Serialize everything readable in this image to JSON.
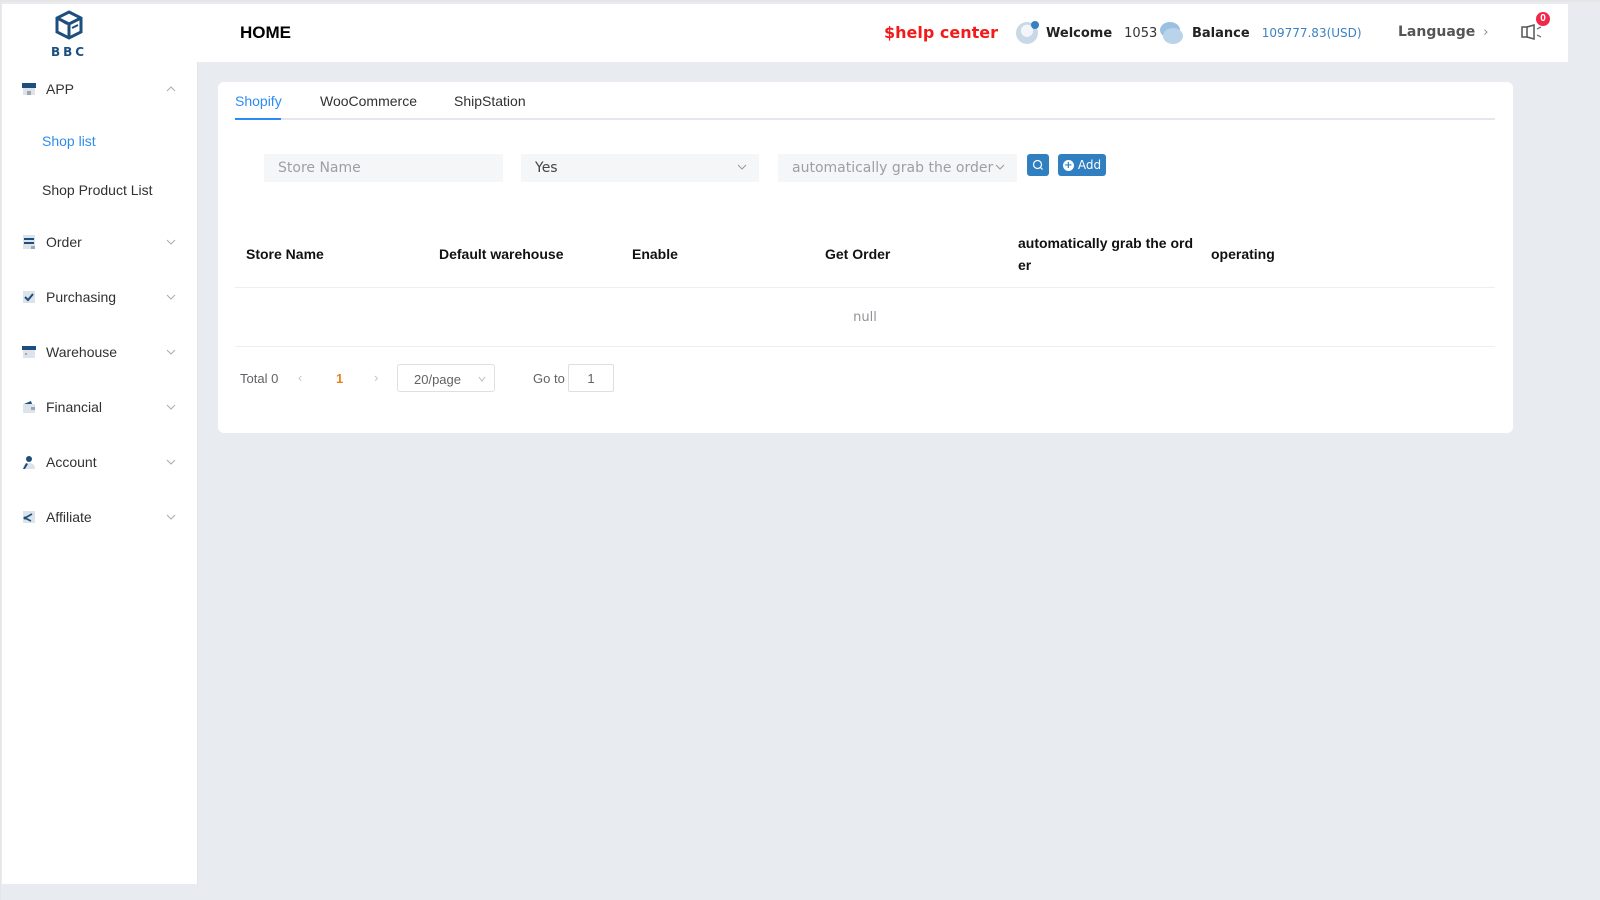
{
  "header": {
    "logo_text": "BBC",
    "title": "HOME",
    "help_center": "$help center",
    "welcome_label": "Welcome",
    "user_id": "1053",
    "balance_label": "Balance",
    "balance_value": "109777.83(USD)",
    "language_label": "Language",
    "notification_count": "0"
  },
  "sidebar": {
    "items": [
      {
        "label": "APP",
        "icon": "store-icon",
        "expanded": true,
        "children": [
          {
            "label": "Shop list",
            "active": true
          },
          {
            "label": "Shop Product List",
            "active": false
          }
        ]
      },
      {
        "label": "Order",
        "icon": "order-list-icon",
        "expanded": false
      },
      {
        "label": "Purchasing",
        "icon": "checkbox-icon",
        "expanded": false
      },
      {
        "label": "Warehouse",
        "icon": "warehouse-icon",
        "expanded": false
      },
      {
        "label": "Financial",
        "icon": "wallet-icon",
        "expanded": false
      },
      {
        "label": "Account",
        "icon": "user-icon",
        "expanded": false
      },
      {
        "label": "Affiliate",
        "icon": "share-icon",
        "expanded": false
      }
    ]
  },
  "main": {
    "tabs": [
      {
        "label": "Shopify",
        "active": true
      },
      {
        "label": "WooCommerce",
        "active": false
      },
      {
        "label": "ShipStation",
        "active": false
      }
    ],
    "filters": {
      "store_name_placeholder": "Store Name",
      "enable_value": "Yes",
      "grab_placeholder": "automatically grab the order",
      "add_label": "Add"
    },
    "table": {
      "columns": [
        "Store Name",
        "Default warehouse",
        "Enable",
        "Get Order",
        "automatically grab the order",
        "operating"
      ],
      "rows": [],
      "empty_text": "null"
    },
    "pagination": {
      "total_label": "Total 0",
      "current_page": "1",
      "page_size": "20/page",
      "goto_label": "Go to",
      "goto_value": "1"
    }
  },
  "colors": {
    "accent": "#2d8cf0",
    "button": "#2f7fc1",
    "help": "#f21b1b",
    "badge": "#f0294a",
    "current_page": "#e6831c",
    "background": "#e8ecf0"
  }
}
